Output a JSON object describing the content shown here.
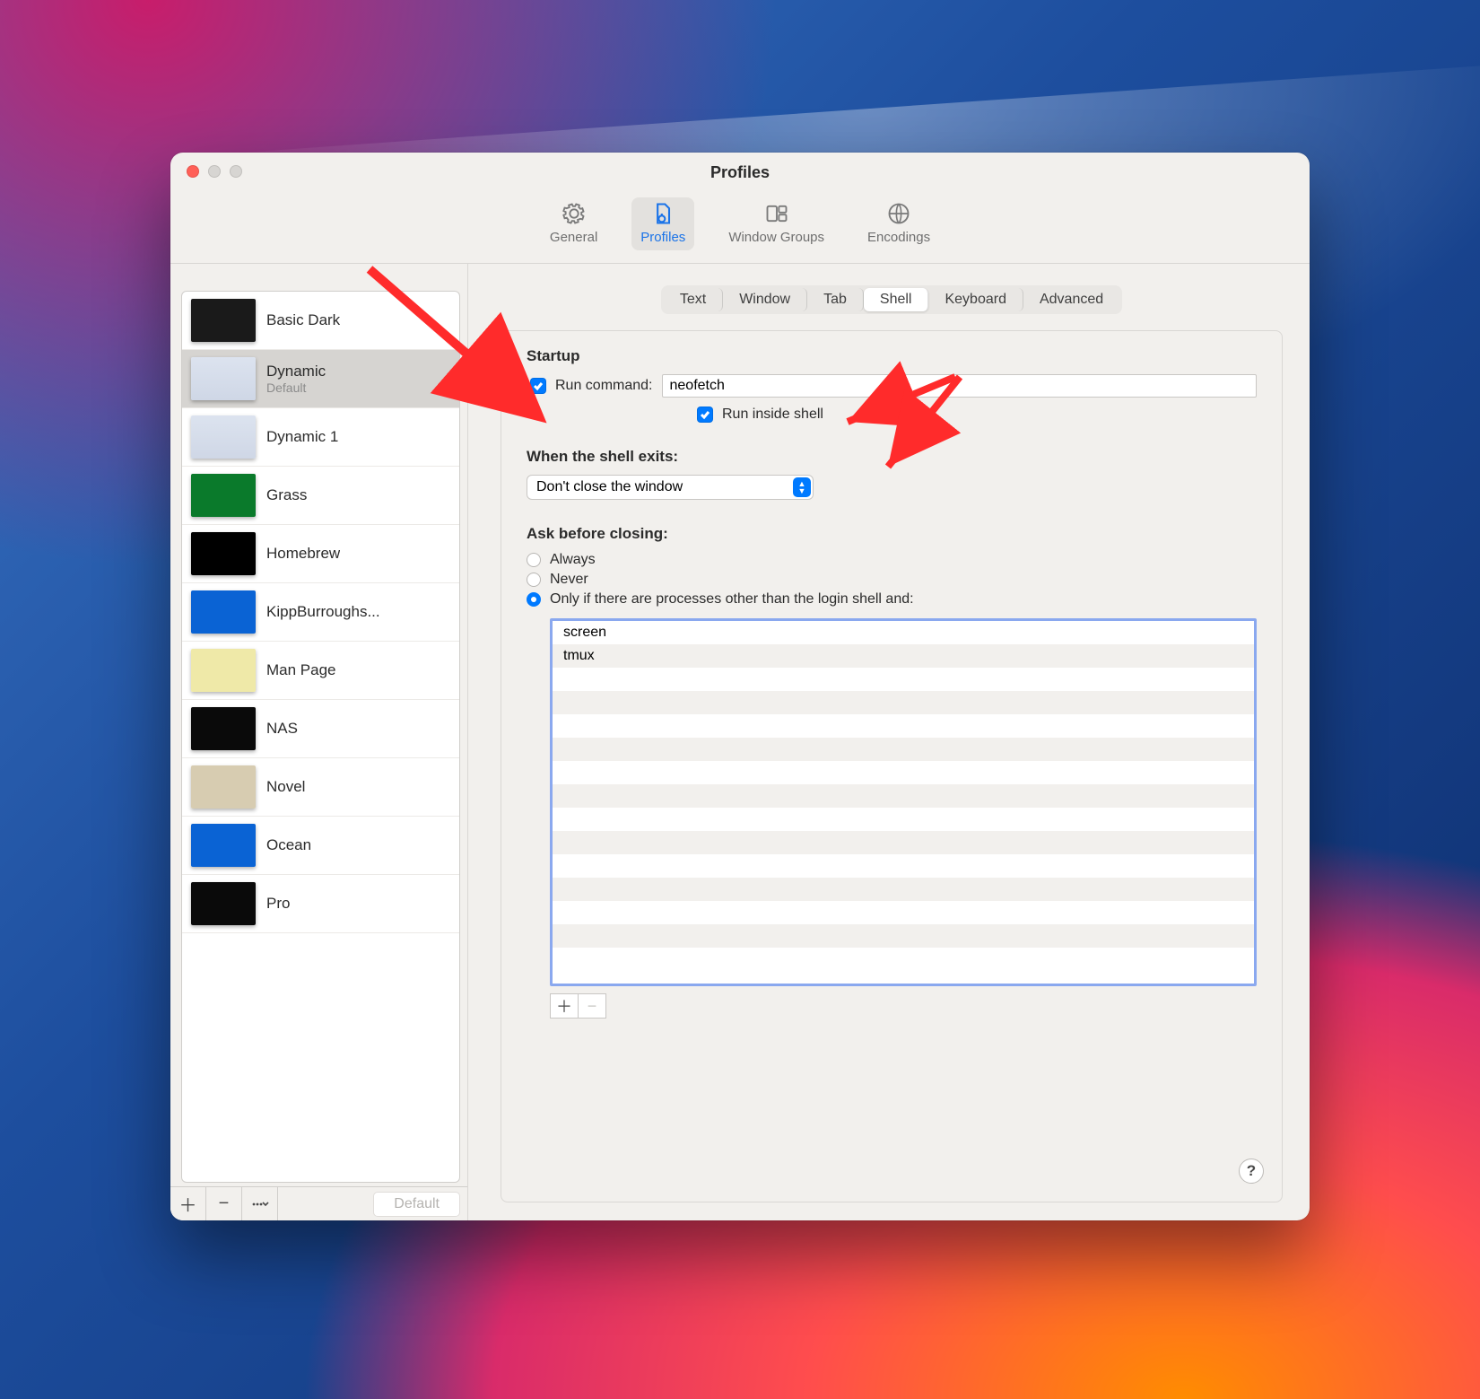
{
  "window": {
    "title": "Profiles"
  },
  "toolbar": {
    "general": "General",
    "profiles": "Profiles",
    "window_groups": "Window Groups",
    "encodings": "Encodings"
  },
  "sidebar": {
    "profiles": [
      {
        "name": "Basic Dark",
        "swatch": "linear-gradient(#1a1a1a,#1a1a1a)"
      },
      {
        "name": "Dynamic",
        "subtitle": "Default",
        "selected": true,
        "swatch": "linear-gradient(#dce3ef,#cfd7e6)"
      },
      {
        "name": "Dynamic 1",
        "swatch": "linear-gradient(#dce3ef,#cfd7e6)"
      },
      {
        "name": "Grass",
        "swatch": "linear-gradient(#0a7a2b,#0a7a2b)"
      },
      {
        "name": "Homebrew",
        "swatch": "linear-gradient(#000,#000)"
      },
      {
        "name": "KippBurroughs...",
        "swatch": "linear-gradient(#0a63d4,#0a63d4)"
      },
      {
        "name": "Man Page",
        "swatch": "linear-gradient(#efe9a8,#efe9a8)"
      },
      {
        "name": "NAS",
        "swatch": "linear-gradient(#0a0a0a,#0a0a0a)"
      },
      {
        "name": "Novel",
        "swatch": "linear-gradient(#d7ccb1,#d7ccb1)"
      },
      {
        "name": "Ocean",
        "swatch": "linear-gradient(#0a63d4,#0a63d4)"
      },
      {
        "name": "Pro",
        "swatch": "linear-gradient(#0a0a0a,#0a0a0a)"
      }
    ],
    "default_button": "Default"
  },
  "content": {
    "tabs": [
      "Text",
      "Window",
      "Tab",
      "Shell",
      "Keyboard",
      "Advanced"
    ],
    "selected_tab": "Shell",
    "startup_heading": "Startup",
    "run_command_label": "Run command:",
    "run_command_value": "neofetch",
    "run_inside_shell_label": "Run inside shell",
    "shell_exit_heading": "When the shell exits:",
    "shell_exit_value": "Don't close the window",
    "ask_before_closing_heading": "Ask before closing:",
    "ask_options": {
      "always": "Always",
      "never": "Never",
      "only_if": "Only if there are processes other than the login shell and:"
    },
    "processes": [
      "screen",
      "tmux"
    ]
  }
}
